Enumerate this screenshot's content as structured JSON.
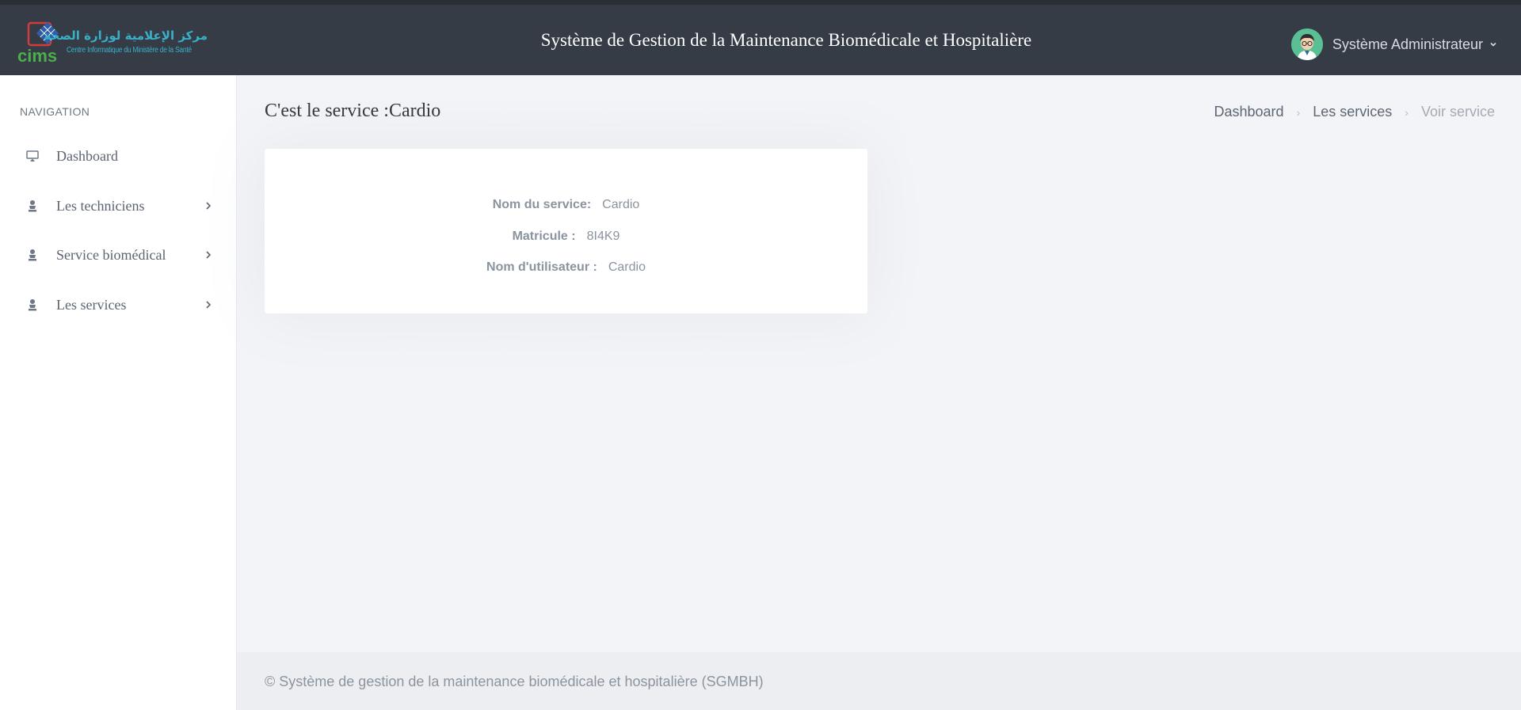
{
  "header": {
    "logo": {
      "arabic_text": "مركز الإعلامية لوزارة الصحة",
      "french_text": "Centre Informatique du Ministère de la Santé",
      "mark_text": "cims"
    },
    "app_title": "Système de Gestion de la Maintenance Biomédicale et Hospitalière",
    "user": {
      "name": "Système Administrateur",
      "avatar_icon": "user-avatar-icon"
    }
  },
  "sidebar": {
    "heading": "NAVIGATION",
    "items": [
      {
        "label": "Dashboard",
        "icon": "monitor-icon",
        "has_submenu": false
      },
      {
        "label": "Les techniciens",
        "icon": "person-icon",
        "has_submenu": true
      },
      {
        "label": "Service biomédical",
        "icon": "person-icon",
        "has_submenu": true
      },
      {
        "label": "Les services",
        "icon": "person-icon",
        "has_submenu": true
      }
    ]
  },
  "main": {
    "page_title": "C'est le service :Cardio",
    "breadcrumb": [
      "Dashboard",
      "Les services",
      "Voir service"
    ],
    "details": [
      {
        "label": "Nom du service:",
        "value": "Cardio"
      },
      {
        "label": "Matricule :",
        "value": "8I4K9"
      },
      {
        "label": "Nom d'utilisateur :",
        "value": "Cardio"
      }
    ]
  },
  "footer": {
    "text": "© Système de gestion de la maintenance biomédicale et hospitalière (SGMBH)"
  },
  "colors": {
    "header_bg": "#353c46",
    "sidebar_bg": "#ffffff",
    "content_bg": "#f3f4f7",
    "card_bg": "#ffffff",
    "logo_accent": "#3ab0c8"
  }
}
